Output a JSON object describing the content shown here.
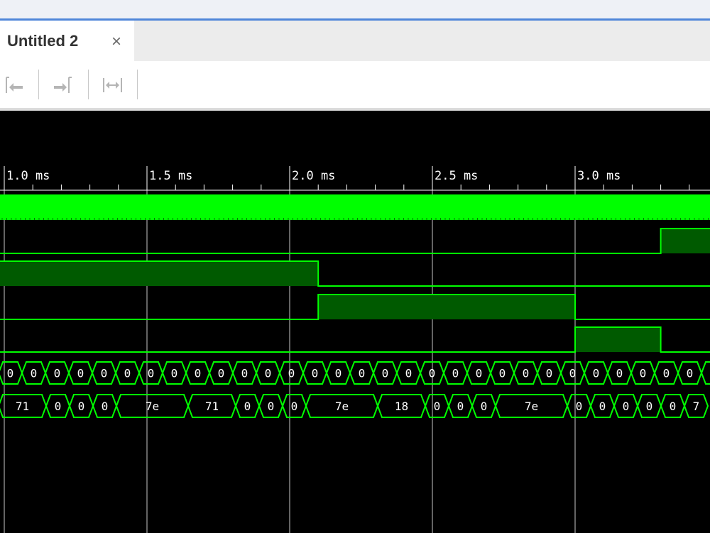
{
  "window": {
    "tab_title": "Untitled 2",
    "tab_close_icon": "×"
  },
  "toolbar": {
    "buttons": [
      {
        "name": "go-to-start-icon",
        "enabled": false
      },
      {
        "name": "go-to-end-icon",
        "enabled": false
      },
      {
        "name": "zoom-fit-icon",
        "enabled": false
      }
    ]
  },
  "waveform": {
    "background": "#000000",
    "signal_color": "#00ff00",
    "fill_color": "#005a00",
    "timeline": {
      "start_ms": 0.99,
      "ms_per_major": 0.5,
      "minor_per_major": 5,
      "labels": [
        "1.0 ms",
        "1.5 ms",
        "2.0 ms",
        "2.5 ms",
        "3.0 ms"
      ]
    },
    "signals": [
      {
        "kind": "clock"
      },
      {
        "kind": "bit",
        "initial": 0,
        "transitions_ms": [
          3.3
        ]
      },
      {
        "kind": "bit",
        "initial": 1,
        "transitions_ms": [
          2.1
        ]
      },
      {
        "kind": "bit",
        "initial": 0,
        "transitions_ms": [
          2.1,
          3.0
        ]
      },
      {
        "kind": "bit",
        "initial": 0,
        "transitions_ms": [
          3.0,
          3.3
        ]
      },
      {
        "kind": "bus",
        "segments": []
      },
      {
        "kind": "bus",
        "segments": [
          {
            "value": "71"
          },
          {
            "value": "0"
          },
          {
            "value": "0"
          },
          {
            "value": "0"
          },
          {
            "value": "7e"
          },
          {
            "value": "71"
          },
          {
            "value": "0"
          },
          {
            "value": "0"
          },
          {
            "value": "0"
          },
          {
            "value": "7e"
          },
          {
            "value": "18"
          },
          {
            "value": "0"
          },
          {
            "value": "0"
          },
          {
            "value": "0"
          },
          {
            "value": "7e"
          },
          {
            "value": "0"
          },
          {
            "value": "0"
          },
          {
            "value": "0"
          },
          {
            "value": "0"
          },
          {
            "value": "0"
          },
          {
            "value": "7"
          }
        ]
      }
    ]
  }
}
